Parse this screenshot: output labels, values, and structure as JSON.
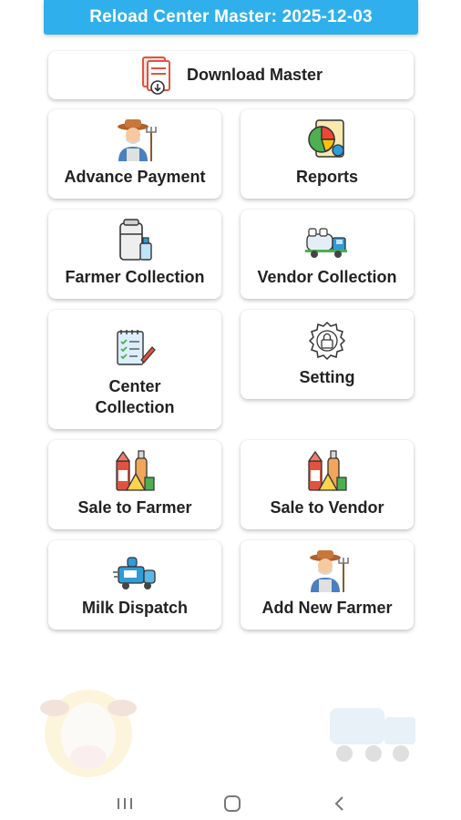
{
  "header": {
    "title": "Reload Center Master: 2025-12-03"
  },
  "download": {
    "label": "Download Master",
    "icon": "document-download-icon"
  },
  "tiles": [
    {
      "label": "Advance Payment",
      "icon": "farmer-icon"
    },
    {
      "label": "Reports",
      "icon": "pie-chart-report-icon"
    },
    {
      "label": "Farmer Collection",
      "icon": "milk-can-icon"
    },
    {
      "label": "Vendor Collection",
      "icon": "milk-truck-icon"
    },
    {
      "label": "Center Collection",
      "icon": "checklist-icon"
    },
    {
      "label": "Setting",
      "icon": "gear-lock-icon"
    },
    {
      "label": "Sale to Farmer",
      "icon": "dairy-products-icon"
    },
    {
      "label": "Sale to Vendor",
      "icon": "dairy-products-icon"
    },
    {
      "label": "Milk Dispatch",
      "icon": "dispatch-van-icon"
    },
    {
      "label": "Add New Farmer",
      "icon": "farmer-icon"
    }
  ],
  "navbar": {
    "recents": "recents-icon",
    "home": "home-icon",
    "back": "back-icon"
  },
  "colors": {
    "header": "#2fb0ec",
    "text": "#222222"
  }
}
